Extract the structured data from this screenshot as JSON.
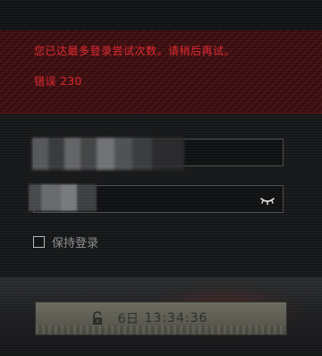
{
  "error": {
    "message": "您已达最多登录尝试次数。请稍后再试。",
    "code": "错误 230"
  },
  "form": {
    "username": {
      "value": "",
      "placeholder": ""
    },
    "password": {
      "value": "",
      "placeholder": ""
    },
    "remember_me": {
      "label": "保持登录",
      "checked": false
    }
  },
  "lockout": {
    "days": "6日",
    "time": "13:34:36"
  },
  "colors": {
    "error_text": "#e0282e",
    "error_bg": "#3a0b0d",
    "lock_button_bg": "#5a594f"
  },
  "icons": {
    "reveal": "eye-closed-icon",
    "lock": "padlock-icon"
  }
}
